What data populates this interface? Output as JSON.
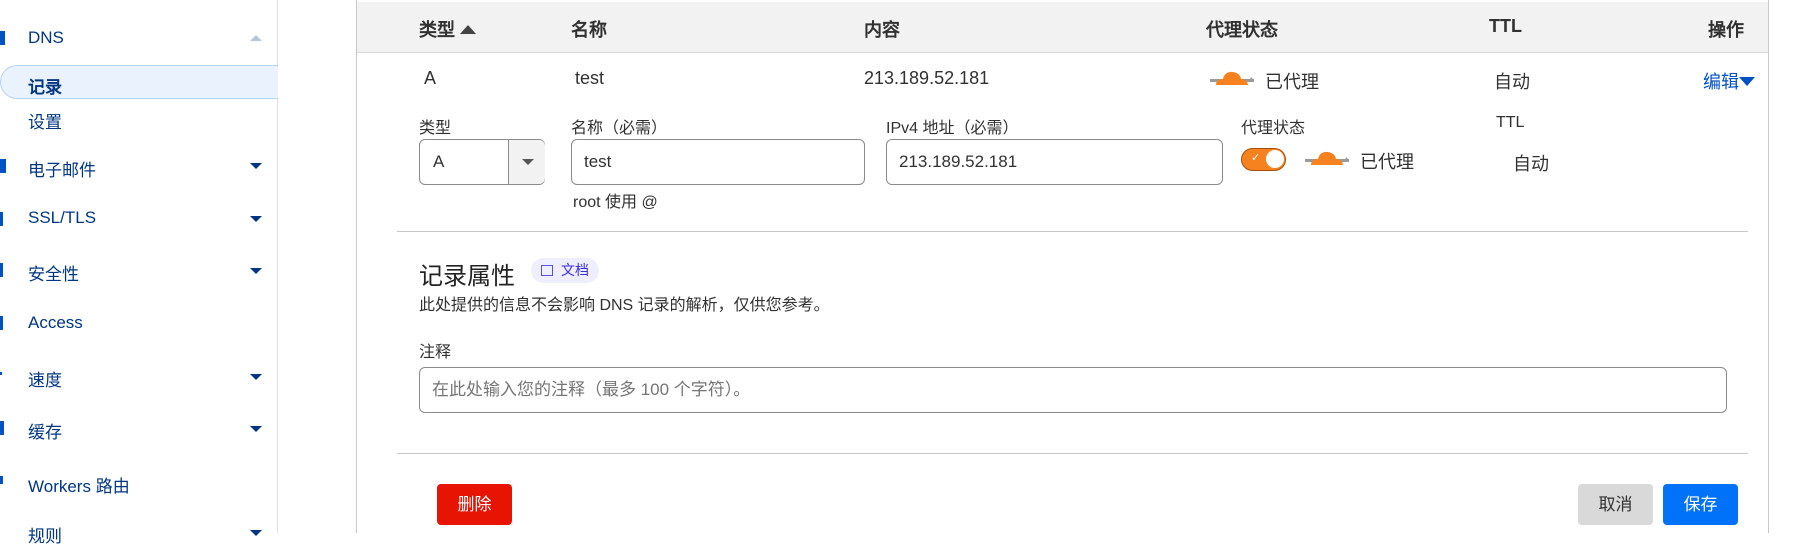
{
  "sidebar": {
    "items": [
      {
        "label": "DNS",
        "icon": "dns-icon",
        "expanded": true
      },
      {
        "label": "记录",
        "active": true
      },
      {
        "label": "设置"
      },
      {
        "label": "电子邮件",
        "icon": "email-icon"
      },
      {
        "label": "SSL/TLS",
        "icon": "lock-icon"
      },
      {
        "label": "安全性",
        "icon": "shield-icon"
      },
      {
        "label": "Access",
        "icon": "access-icon"
      },
      {
        "label": "速度",
        "icon": "speed-icon"
      },
      {
        "label": "缓存",
        "icon": "cache-icon"
      },
      {
        "label": "Workers 路由",
        "icon": "workers-icon"
      },
      {
        "label": "规则",
        "icon": "rules-icon"
      }
    ]
  },
  "table": {
    "headers": [
      "类型",
      "名称",
      "内容",
      "代理状态",
      "TTL",
      "操作"
    ],
    "row": {
      "type": "A",
      "name": "test",
      "content": "213.189.52.181",
      "proxy": "已代理",
      "ttl": "自动",
      "action": "编辑"
    }
  },
  "form": {
    "type_label": "类型",
    "type_value": "A",
    "name_label": "名称（必需）",
    "name_value": "test",
    "name_hint": "root 使用 @",
    "ipv4_label": "IPv4 地址（必需）",
    "ipv4_value": "213.189.52.181",
    "proxy_label": "代理状态",
    "proxy_value": "已代理",
    "proxy_on": true,
    "ttl_label": "TTL",
    "ttl_value": "自动"
  },
  "attributes": {
    "title": "记录属性",
    "docs_label": "文档",
    "description": "此处提供的信息不会影响 DNS 记录的解析，仅供您参考。",
    "comment_label": "注释",
    "comment_placeholder": "在此处输入您的注释（最多 100 个字符）。"
  },
  "buttons": {
    "delete": "删除",
    "cancel": "取消",
    "save": "保存"
  },
  "colors": {
    "accent": "#0051c3",
    "proxy_orange": "#f6821f",
    "delete": "#e81403",
    "save": "#0072fa"
  }
}
